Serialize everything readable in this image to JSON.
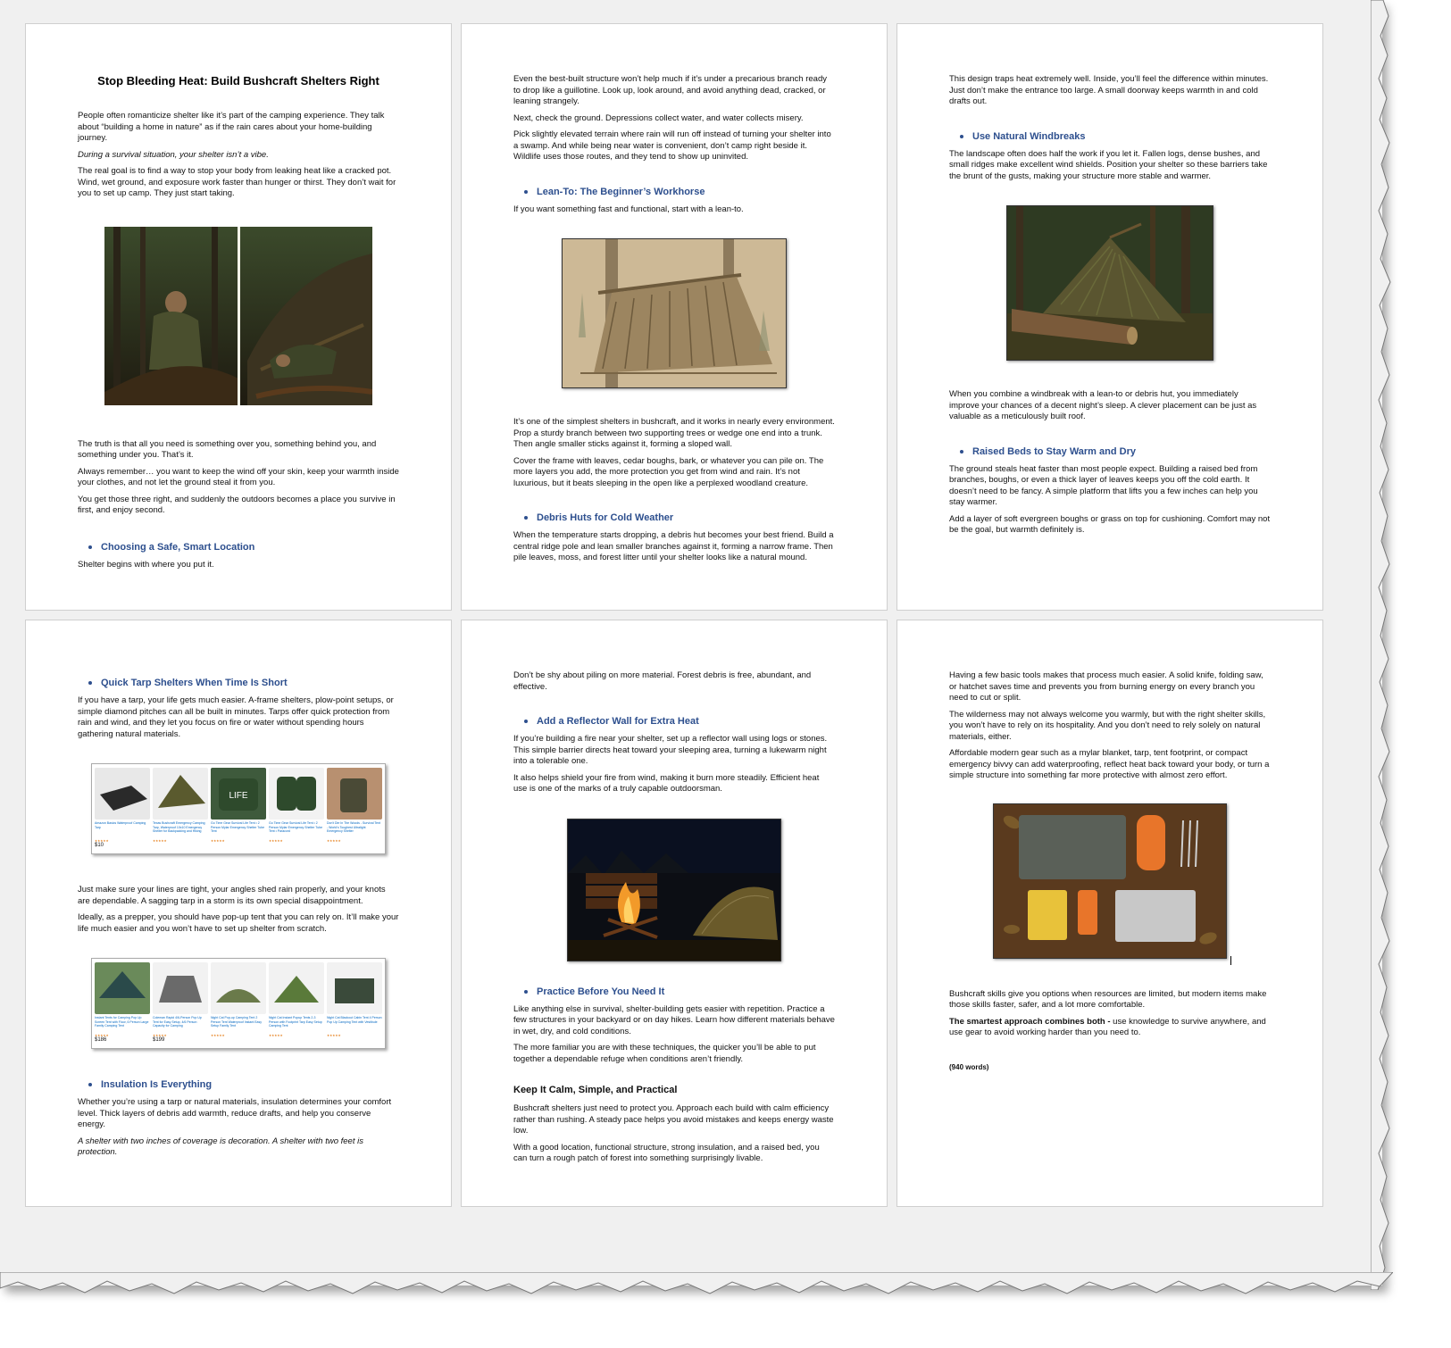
{
  "document": {
    "title": "Stop Bleeding Heat: Build Bushcraft Shelters Right",
    "pages": [
      {
        "blocks": [
          {
            "type": "title",
            "text": "Stop Bleeding Heat: Build Bushcraft Shelters Right"
          },
          {
            "type": "p",
            "text": "People often romanticize shelter like it’s part of the camping experience. They talk about “building a home in nature” as if the rain cares about your home-building journey."
          },
          {
            "type": "pi",
            "text": "During a survival situation, your shelter isn’t a vibe."
          },
          {
            "type": "p",
            "text": "The real goal is to find a way to stop your body from leaking heat like a cracked pot. Wind, wet ground, and exposure work faster than hunger or thirst. They don’t wait for you to set up camp. They just start taking."
          },
          {
            "type": "image",
            "name": "man-building-debris-shelter-image"
          },
          {
            "type": "p",
            "text": "The truth is that all you need is something over you, something behind you, and something under you. That’s it."
          },
          {
            "type": "p",
            "text": "Always remember… you want to keep the wind off your skin, keep your warmth inside your clothes, and not let the ground steal it from you."
          },
          {
            "type": "p",
            "text": "You get those three right, and suddenly the outdoors becomes a place you survive in first, and enjoy second."
          },
          {
            "type": "bh",
            "text": "Choosing a Safe, Smart Location"
          },
          {
            "type": "p",
            "text": "Shelter begins with where you put it."
          }
        ]
      },
      {
        "blocks": [
          {
            "type": "p",
            "text": "Even the best-built structure won’t help much if it’s under a precarious branch ready to drop like a guillotine. Look up, look around, and avoid anything dead, cracked, or leaning strangely."
          },
          {
            "type": "p",
            "text": "Next, check the ground. Depressions collect water, and water collects misery."
          },
          {
            "type": "p",
            "text": "Pick slightly elevated terrain where rain will run off instead of turning your shelter into a swamp. And while being near water is convenient, don’t camp right beside it. Wildlife uses those routes, and they tend to show up uninvited."
          },
          {
            "type": "bh",
            "text": "Lean-To: The Beginner’s Workhorse"
          },
          {
            "type": "p",
            "text": "If you want something fast and functional, start with a lean-to."
          },
          {
            "type": "image",
            "name": "lean-to-sketch-image"
          },
          {
            "type": "p",
            "text": "It’s one of the simplest shelters in bushcraft, and it works in nearly every environment. Prop a sturdy branch between two supporting trees or wedge one end into a trunk. Then angle smaller sticks against it, forming a sloped wall."
          },
          {
            "type": "p",
            "text": "Cover the frame with leaves, cedar boughs, bark, or whatever you can pile on. The more layers you add, the more protection you get from wind and rain. It’s not luxurious, but it beats sleeping in the open like a perplexed woodland creature."
          },
          {
            "type": "bh",
            "text": "Debris Huts for Cold Weather"
          },
          {
            "type": "p",
            "text": "When the temperature starts dropping, a debris hut becomes your best friend. Build a central ridge pole and lean smaller branches against it, forming a narrow frame. Then pile leaves, moss, and forest litter until your shelter looks like a natural mound."
          }
        ]
      },
      {
        "blocks": [
          {
            "type": "p",
            "text": "This design traps heat extremely well. Inside, you’ll feel the difference within minutes. Just don’t make the entrance too large. A small doorway keeps warmth in and cold drafts out."
          },
          {
            "type": "bh",
            "text": "Use Natural Windbreaks"
          },
          {
            "type": "p",
            "text": "The landscape often does half the work if you let it. Fallen logs, dense bushes, and small ridges make excellent wind shields. Position your shelter so these barriers take the brunt of the gusts, making your structure more stable and warmer."
          },
          {
            "type": "image",
            "name": "windbreak-log-shelter-image"
          },
          {
            "type": "p",
            "text": "When you combine a windbreak with a lean-to or debris hut, you immediately improve your chances of a decent night’s sleep. A clever placement can be just as valuable as a meticulously built roof."
          },
          {
            "type": "bh",
            "text": "Raised Beds to Stay Warm and Dry"
          },
          {
            "type": "p",
            "text": "The ground steals heat faster than most people expect. Building a raised bed from branches, boughs, or even a thick layer of leaves keeps you off the cold earth. It doesn’t need to be fancy. A simple platform that lifts you a few inches can help you stay warmer."
          },
          {
            "type": "p",
            "text": "Add a layer of soft evergreen boughs or grass on top for cushioning. Comfort may not be the goal, but warmth definitely is."
          }
        ]
      },
      {
        "blocks": [
          {
            "type": "bh",
            "text": "Quick Tarp Shelters When Time Is Short"
          },
          {
            "type": "p",
            "text": "If you have a tarp, your life gets much easier. A-frame shelters, plow-point setups, or simple diamond pitches can all be built in minutes. Tarps offer quick protection from rain and wind, and they let you focus on fire or water without spending hours gathering natural materials."
          },
          {
            "type": "strip",
            "name": "tarp-products-strip"
          },
          {
            "type": "p",
            "text": "Just make sure your lines are tight, your angles shed rain properly, and your knots are dependable. A sagging tarp in a storm is its own special disappointment."
          },
          {
            "type": "p",
            "text": "Ideally, as a prepper, you should have pop-up tent that you can rely on. It’ll make your life much easier and you won’t have to set up shelter from scratch."
          },
          {
            "type": "strip",
            "name": "tent-products-strip"
          },
          {
            "type": "bh",
            "text": "Insulation Is Everything"
          },
          {
            "type": "p",
            "text": "Whether you’re using a tarp or natural materials, insulation determines your comfort level. Thick layers of debris add warmth, reduce drafts, and help you conserve energy."
          },
          {
            "type": "pi",
            "text": "A shelter with two inches of coverage is decoration. A shelter with two feet is protection."
          }
        ]
      },
      {
        "blocks": [
          {
            "type": "p",
            "text": "Don’t be shy about piling on more material. Forest debris is free, abundant, and effective."
          },
          {
            "type": "bh",
            "text": "Add a Reflector Wall for Extra Heat"
          },
          {
            "type": "p",
            "text": "If you’re building a fire near your shelter, set up a reflector wall using logs or stones. This simple barrier directs heat toward your sleeping area, turning a lukewarm night into a tolerable one."
          },
          {
            "type": "p",
            "text": "It also helps shield your fire from wind, making it burn more steadily. Efficient heat use is one of the marks of a truly capable outdoorsman."
          },
          {
            "type": "image",
            "name": "campfire-reflector-tent-image"
          },
          {
            "type": "bh",
            "text": "Practice Before You Need It"
          },
          {
            "type": "p",
            "text": "Like anything else in survival, shelter-building gets easier with repetition. Practice a few structures in your backyard or on day hikes. Learn how different materials behave in wet, dry, and cold conditions."
          },
          {
            "type": "p",
            "text": "The more familiar you are with these techniques, the quicker you’ll be able to put together a dependable refuge when conditions aren’t friendly."
          },
          {
            "type": "h3",
            "text": "Keep It Calm, Simple, and Practical"
          },
          {
            "type": "p",
            "text": "Bushcraft shelters just need to protect you. Approach each build with calm efficiency rather than rushing. A steady pace helps you avoid mistakes and keeps energy waste low."
          },
          {
            "type": "p",
            "text": "With a good location, functional structure, strong insulation, and a raised bed, you can turn a rough patch of forest into something surprisingly livable."
          }
        ]
      },
      {
        "blocks": [
          {
            "type": "p",
            "text": "Having a few basic tools makes that process much easier. A solid knife, folding saw, or hatchet saves time and prevents you from burning energy on every branch you need to cut or split."
          },
          {
            "type": "p",
            "text": "The wilderness may not always welcome you warmly, but with the right shelter skills, you won’t have to rely on its hospitality. And you don’t need to rely solely on natural materials, either."
          },
          {
            "type": "p",
            "text": "Affordable modern gear such as a mylar blanket, tarp, tent footprint, or compact emergency bivvy can add waterproofing, reflect heat back toward your body, or turn a simple structure into something far more protective with almost zero effort."
          },
          {
            "type": "image",
            "name": "shelter-gear-flatlay-image"
          },
          {
            "type": "p",
            "text": "Bushcraft skills give you options when resources are limited, but modern items make those skills faster, safer, and a lot more comfortable."
          },
          {
            "type": "pb",
            "bold": "The smartest approach combines both - ",
            "text": "use knowledge to survive anywhere, and use gear to avoid working harder than you need to."
          },
          {
            "type": "small",
            "text": "(940 words)"
          }
        ]
      }
    ],
    "tarp_products": [
      {
        "title": "Amazon Basics Waterproof Camping Tarp",
        "price": "$10",
        "stars": "★★★★★"
      },
      {
        "title": "Texas Bushcraft Emergency Camping Tarp, Waterproof 10x10 Emergency Shelter for Backpacking and Hiking",
        "price": "",
        "stars": "★★★★★"
      },
      {
        "title": "Go Time Gear Survival Life Tent • 2 Person Mylar Emergency Shelter Tube Tent",
        "price": "",
        "stars": "★★★★★"
      },
      {
        "title": "Go Time Gear Survival Life Tent • 2 Person Mylar Emergency Shelter Tube Tent • Paracord",
        "price": "",
        "stars": "★★★★★"
      },
      {
        "title": "Don't Die In The Woods - Survival Tent - World's Toughest Ultralight Emergency Shelter",
        "price": "",
        "stars": "★★★★★"
      }
    ],
    "tent_products": [
      {
        "title": "Instant Tents for Camping Pop Up Screen Tent with Floor, 6 Person Large Family Camping Tent",
        "price": "$186",
        "stars": "★★★★★"
      },
      {
        "title": "Coleman Rapid 4/6-Person Pop Up Tent for Easy Setup, 4/6 Person Capacity for Camping",
        "price": "$199",
        "stars": "★★★★★"
      },
      {
        "title": "Night Cat Pop-up Camping Tent 2 Person Tent Waterproof Instant Easy Setup Family Tent",
        "price": "",
        "stars": "★★★★★"
      },
      {
        "title": "Night Cat Instant Popup Tents 2-3 Person with Footprint Tarp Easy Setup Camping Tent",
        "price": "",
        "stars": "★★★★★"
      },
      {
        "title": "Night Cat Blackout Cabin Tent 4 Person Pop Up Camping Tent with Vestibule",
        "price": "",
        "stars": "★★★★★"
      }
    ],
    "colors": {
      "heading_blue": "#2d4f8e",
      "text": "#111111",
      "page_bg": "#ffffff",
      "frame_bg": "#f0f0f0"
    }
  }
}
